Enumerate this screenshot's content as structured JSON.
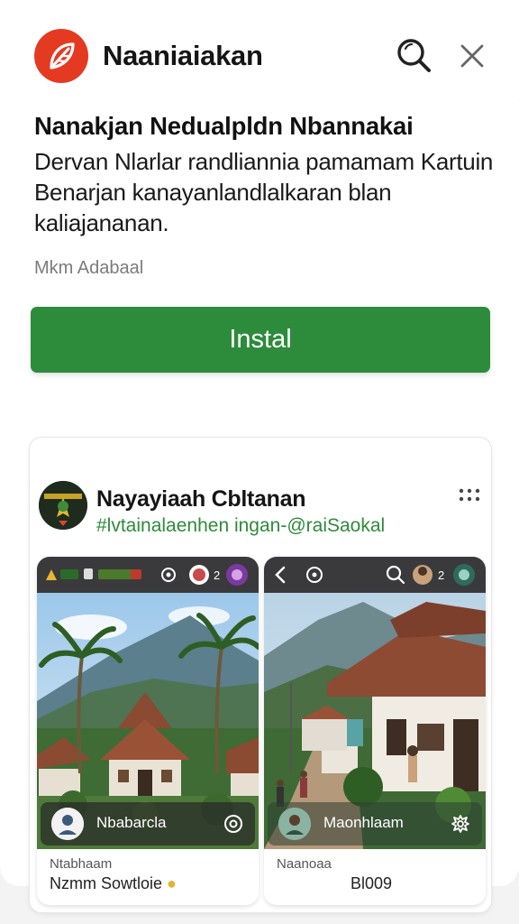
{
  "header": {
    "title": "Naaniaiakan",
    "logo_icon": "leaf-icon",
    "search_icon": "search-icon",
    "close_icon": "close-icon"
  },
  "app": {
    "headline": "Nanakjan Nedualpldn Nbannakai",
    "description": "Dervan Nlarlar randliannia pamamam Kartuin Benarjan kanayanlandlalkaran blan kaliajananan.",
    "meta": "Mkm Adabaal",
    "install_label": "Instal",
    "install_color": "#2d8c3c"
  },
  "post": {
    "author": "Nayayiaah Cbltanan",
    "subtitle": "#lvtainalaenhen ingan-@raiSaokal",
    "more_icon": "more-dots-icon",
    "shots": [
      {
        "overlay_label": "Nbabarcla",
        "overlay_icon": "settings-circle-icon",
        "caption_top": "Ntabhaam",
        "caption_bottom": "Nzmm Sowtloie",
        "caption_icon": "bulb-icon",
        "topbar_count": "2"
      },
      {
        "overlay_label": "Maonhlaam",
        "overlay_icon": "gear-icon",
        "caption_top": "Naanoaa",
        "caption_bottom": "Bl009",
        "topbar_count": "2"
      }
    ]
  }
}
